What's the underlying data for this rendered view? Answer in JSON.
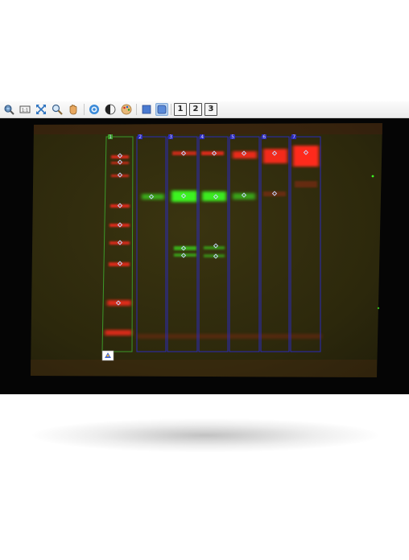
{
  "toolbar": {
    "buttons": [
      {
        "icon": "zoom-region-icon"
      },
      {
        "icon": "zoom-100-icon"
      },
      {
        "icon": "fit-to-window-icon"
      },
      {
        "icon": "magnifier-icon"
      },
      {
        "icon": "hand-pan-icon"
      },
      {
        "icon": "brightness-icon"
      },
      {
        "icon": "contrast-icon"
      },
      {
        "icon": "palette-icon"
      },
      {
        "icon": "rectangle-shape-icon"
      },
      {
        "icon": "lane-shape-icon"
      },
      {
        "label": "1"
      },
      {
        "label": "2"
      },
      {
        "label": "3"
      }
    ]
  },
  "colors": {
    "membrane": "#2e2a0c",
    "lane_outline": "#2a2ab8",
    "ladder_outline": "#3c9a2a",
    "red_band": "#ff2a1a",
    "green_band": "#3cff22",
    "marker": "#c8d8ff"
  },
  "lanes": {
    "labels": [
      "1",
      "2",
      "3",
      "4",
      "5",
      "6",
      "7"
    ],
    "ladder_lane": "1"
  }
}
